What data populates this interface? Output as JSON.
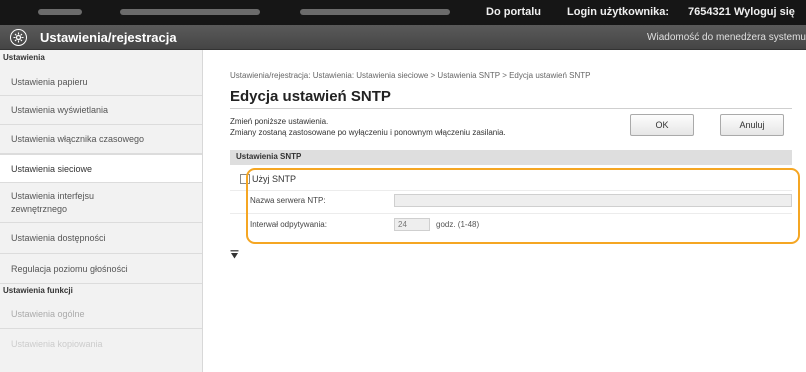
{
  "topbar": {
    "portal_link": "Do portalu",
    "login_label": "Login użytkownika:",
    "login_id": "7654321",
    "logout_link": "Wyloguj się"
  },
  "titlebar": {
    "app_icon": "settings-gear-icon",
    "app_title": "Ustawienia/rejestracja",
    "admin_message": "Wiadomość do menedżera systemu"
  },
  "sidebar": {
    "section_settings": "Ustawienia",
    "items": [
      {
        "label": "Ustawienia papieru"
      },
      {
        "label": "Ustawienia wyświetlania"
      },
      {
        "label": "Ustawienia włącznika czasowego"
      },
      {
        "label": "Ustawienia sieciowe",
        "active": true
      },
      {
        "label": "Ustawienia interfejsu zewnętrznego"
      },
      {
        "label": "Ustawienia dostępności"
      },
      {
        "label": "Regulacja poziomu głośności"
      }
    ],
    "section_functions": "Ustawienia funkcji",
    "function_items": [
      {
        "label": "Ustawienia ogólne"
      },
      {
        "label": "Ustawienia kopiowania"
      }
    ]
  },
  "main": {
    "breadcrumb": "Ustawienia/rejestracja: Ustawienia: Ustawienia sieciowe > Ustawienia SNTP > Edycja ustawień SNTP",
    "page_title": "Edycja ustawień SNTP",
    "description_line1": "Zmień poniższe ustawienia.",
    "description_line2": "Zmiany zostaną zastosowane po wyłączeniu i ponownym włączeniu zasilania.",
    "ok_button": "OK",
    "cancel_button": "Anuluj",
    "section_title": "Ustawienia SNTP",
    "use_sntp_label": "Użyj SNTP",
    "use_sntp_checked": false,
    "ntp_server_label": "Nazwa serwera NTP:",
    "ntp_server_value": "",
    "poll_interval_label": "Interwał odpytywania:",
    "poll_interval_value": "24",
    "poll_interval_unit": "godz. (1-48)",
    "highlight_color": "#f5a623"
  }
}
